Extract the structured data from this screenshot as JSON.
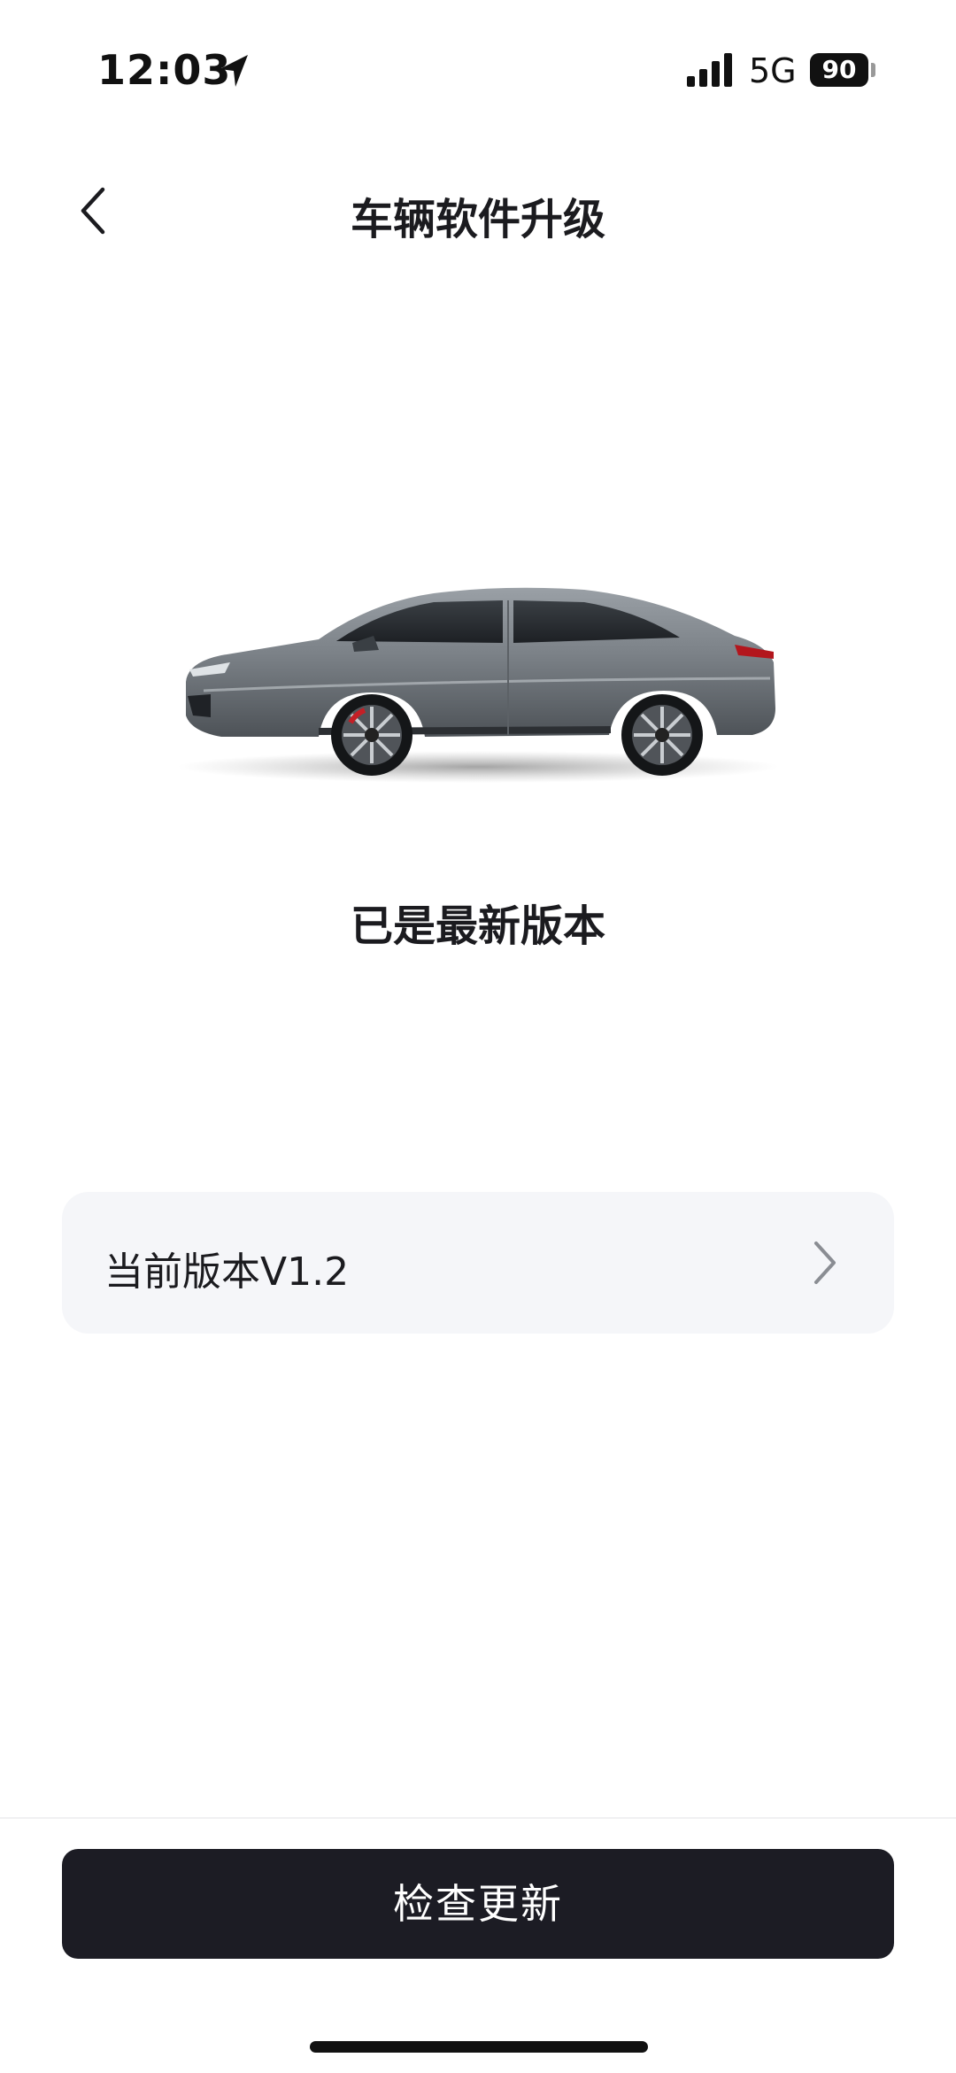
{
  "status_bar": {
    "time": "12:03",
    "network": "5G",
    "battery": "90"
  },
  "header": {
    "title": "车辆软件升级",
    "back_icon": "chevron-left-icon"
  },
  "main": {
    "vehicle_image": "car-side-view",
    "status_message": "已是最新版本",
    "version_row": {
      "label": "当前版本V1.2",
      "icon": "chevron-right-icon"
    }
  },
  "footer": {
    "check_button_label": "检查更新"
  },
  "colors": {
    "primary_button": "#1c1c24",
    "card_background": "#f5f6f9",
    "text": "#1b1b1f"
  }
}
